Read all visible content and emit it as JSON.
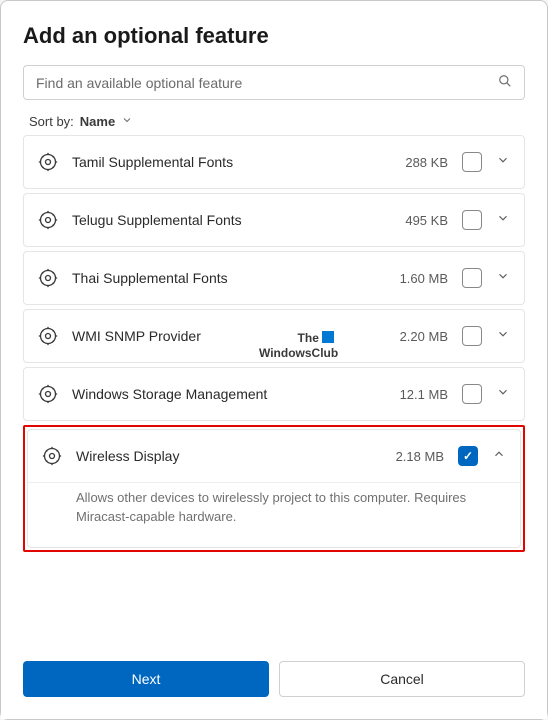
{
  "title": "Add an optional feature",
  "search": {
    "placeholder": "Find an available optional feature"
  },
  "sort": {
    "label": "Sort by:",
    "value": "Name"
  },
  "features": [
    {
      "name": "Tamil Supplemental Fonts",
      "size": "288 KB",
      "checked": false,
      "expanded": false
    },
    {
      "name": "Telugu Supplemental Fonts",
      "size": "495 KB",
      "checked": false,
      "expanded": false
    },
    {
      "name": "Thai Supplemental Fonts",
      "size": "1.60 MB",
      "checked": false,
      "expanded": false
    },
    {
      "name": "WMI SNMP Provider",
      "size": "2.20 MB",
      "checked": false,
      "expanded": false
    },
    {
      "name": "Windows Storage Management",
      "size": "12.1 MB",
      "checked": false,
      "expanded": false
    },
    {
      "name": "Wireless Display",
      "size": "2.18 MB",
      "checked": true,
      "expanded": true,
      "description": "Allows other devices to wirelessly project to this computer. Requires Miracast-capable hardware."
    }
  ],
  "watermark": {
    "line1": "The",
    "line2": "WindowsClub"
  },
  "buttons": {
    "next": "Next",
    "cancel": "Cancel"
  }
}
